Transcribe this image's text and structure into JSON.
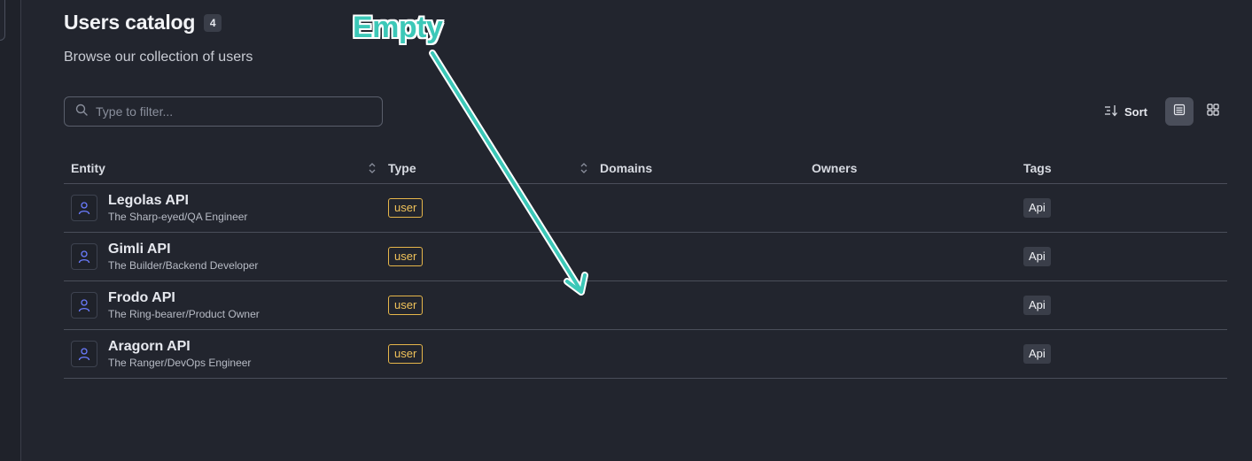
{
  "header": {
    "title": "Users catalog",
    "count": "4",
    "subtitle": "Browse our collection of users"
  },
  "filter": {
    "placeholder": "Type to filter..."
  },
  "toolbar": {
    "sort_label": "Sort",
    "view_modes": [
      "list-view",
      "grid-view"
    ],
    "active_view": "list-view"
  },
  "table": {
    "columns": [
      "Entity",
      "Type",
      "Domains",
      "Owners",
      "Tags"
    ],
    "rows": [
      {
        "name": "Legolas API",
        "description": "The Sharp-eyed/QA Engineer",
        "type": "user",
        "domains": "",
        "owners": "",
        "tag": "Api"
      },
      {
        "name": "Gimli API",
        "description": "The Builder/Backend Developer",
        "type": "user",
        "domains": "",
        "owners": "",
        "tag": "Api"
      },
      {
        "name": "Frodo API",
        "description": "The Ring-bearer/Product Owner",
        "type": "user",
        "domains": "",
        "owners": "",
        "tag": "Api"
      },
      {
        "name": "Aragorn API",
        "description": "The Ranger/DevOps Engineer",
        "type": "user",
        "domains": "",
        "owners": "",
        "tag": "Api"
      }
    ]
  },
  "annotation": {
    "text": "Empty",
    "color": "#3cc8b8"
  },
  "colors": {
    "background": "#22252e",
    "type_badge": "#e6b64a",
    "user_icon": "#6b7cff"
  }
}
